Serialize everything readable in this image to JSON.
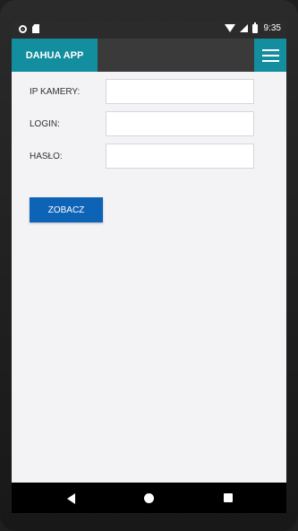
{
  "status_bar": {
    "time": "9:35",
    "icons": [
      "dot-icon",
      "sim-card-icon",
      "wifi-icon",
      "signal-icon",
      "battery-icon"
    ]
  },
  "app_bar": {
    "title": "DAHUA APP",
    "menu_icon": "hamburger-menu-icon",
    "accent_color": "#138e9e"
  },
  "form": {
    "fields": [
      {
        "label": "IP KAMERY:",
        "value": ""
      },
      {
        "label": "LOGIN:",
        "value": ""
      },
      {
        "label": "HASŁO:",
        "value": ""
      }
    ],
    "submit_label": "ZOBACZ",
    "submit_color": "#0d63b6"
  },
  "nav_bar": {
    "icons": [
      "back-icon",
      "home-icon",
      "recents-icon"
    ]
  }
}
